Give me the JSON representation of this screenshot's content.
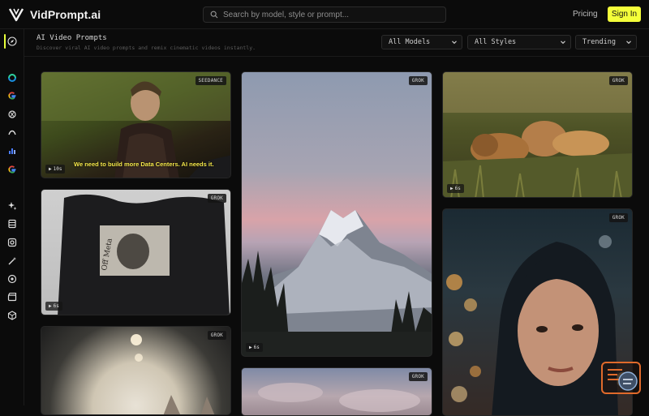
{
  "header": {
    "brand_name": "VidPrompt.ai",
    "search_placeholder": "Search by model, style or prompt...",
    "pricing_label": "Pricing",
    "signin_label": "Sign In",
    "accent_color": "#f4ff3a"
  },
  "sidebar": {
    "items": [
      {
        "icon": "compass-icon",
        "active": true
      },
      {
        "icon": "seedance-logo-icon"
      },
      {
        "icon": "google-icon"
      },
      {
        "icon": "openai-icon"
      },
      {
        "icon": "wave-icon"
      },
      {
        "icon": "bar-chart-icon"
      },
      {
        "icon": "google-icon"
      },
      {
        "icon": "sparkles-icon"
      },
      {
        "icon": "film-icon"
      },
      {
        "icon": "aperture-icon"
      },
      {
        "icon": "magic-wand-icon"
      },
      {
        "icon": "target-icon"
      },
      {
        "icon": "clapperboard-icon"
      },
      {
        "icon": "cube-icon"
      }
    ]
  },
  "subheader": {
    "title": "AI Video Prompts",
    "subtitle": "Discover viral AI video prompts and remix cinematic videos instantly.",
    "filters": {
      "models": "All Models",
      "styles": "All Styles",
      "sort": "Trending"
    }
  },
  "cards": [
    {
      "badge": "SEEDANCE",
      "duration": "10s",
      "caption": "We need to build more Data Centers. AI needs it."
    },
    {
      "badge": "GROK",
      "duration": "6s"
    },
    {
      "badge": "GROK"
    },
    {
      "badge": "GROK",
      "duration": "6s"
    },
    {
      "badge": "GROK"
    },
    {
      "badge": "GROK",
      "duration": "6s"
    },
    {
      "badge": "GROK"
    }
  ]
}
